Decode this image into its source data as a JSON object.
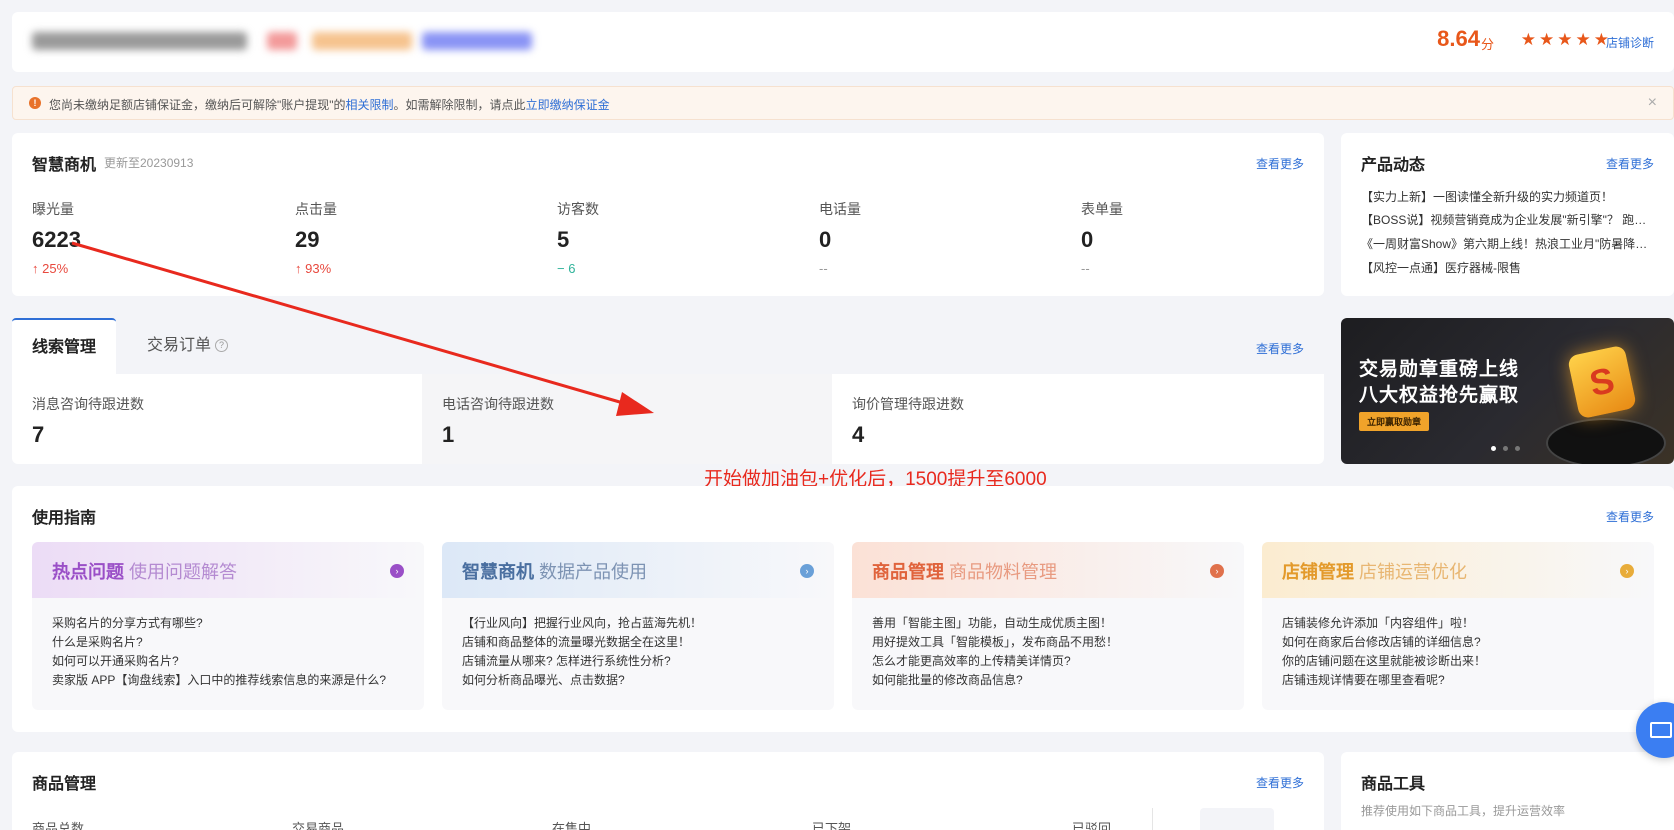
{
  "header": {
    "score": "8.64",
    "score_unit": "分",
    "stars": "★★★★★",
    "diagnosis_link": "店铺诊断"
  },
  "notice": {
    "text_a": "您尚未缴纳足额店铺保证金，缴纳后可解除\"账户提现\"的",
    "link_a": "相关限制",
    "text_b": "。如需解除限制，请点此",
    "link_b": "立即缴纳保证金",
    "close": "×"
  },
  "insights": {
    "title": "智慧商机",
    "update_note": "更新至20230913",
    "more": "查看更多",
    "metrics": [
      {
        "label": "曝光量",
        "value": "6223",
        "change": "25%",
        "trend": "↑"
      },
      {
        "label": "点击量",
        "value": "29",
        "change": "93%",
        "trend": "↑"
      },
      {
        "label": "访客数",
        "value": "5",
        "change": "6",
        "trend": "−"
      },
      {
        "label": "电话量",
        "value": "0",
        "change": "--",
        "trend": ""
      },
      {
        "label": "表单量",
        "value": "0",
        "change": "--",
        "trend": ""
      }
    ]
  },
  "news": {
    "title": "产品动态",
    "more": "查看更多",
    "items": [
      "【实力上新】一图读懂全新升级的实力频道页！",
      "【BOSS说】视频营销竟成为企业发展\"新引擎\"？ 跑…",
      "《一周财富Show》第六期上线！热浪工业月\"防暑降…",
      "【风控一点通】医疗器械-限售"
    ]
  },
  "leads": {
    "tab_active": "线索管理",
    "tab_other": "交易订单",
    "more": "查看更多",
    "boxes": [
      {
        "label": "消息咨询待跟进数",
        "value": "7"
      },
      {
        "label": "电话咨询待跟进数",
        "value": "1"
      },
      {
        "label": "询价管理待跟进数",
        "value": "4"
      }
    ]
  },
  "banner": {
    "line1": "交易勋章重磅上线",
    "line2": "八大权益抢先赢取",
    "button": "立即赢取勋章",
    "badge_letter": "S"
  },
  "annotation": "开始做加油包+优化后，1500提升至6000",
  "guide": {
    "title": "使用指南",
    "more": "查看更多",
    "cards": [
      {
        "bold": "热点问题",
        "rest": "使用问题解答",
        "color": "#9a4fc7",
        "questions": [
          "采购名片的分享方式有哪些?",
          "什么是采购名片?",
          "如何可以开通采购名片?",
          "卖家版 APP【询盘线索】入口中的推荐线索信息的来源是什么?"
        ]
      },
      {
        "bold": "智慧商机",
        "rest": "数据产品使用",
        "color": "#4a82c4",
        "questions": [
          "【行业风向】把握行业风向，抢占蓝海先机！",
          "店铺和商品整体的流量曝光数据全在这里！",
          "店铺流量从哪来? 怎样进行系统性分析?",
          "如何分析商品曝光、点击数据?"
        ]
      },
      {
        "bold": "商品管理",
        "rest": "商品物料管理",
        "color": "#e0633c",
        "questions": [
          "善用「智能主图」功能，自动生成优质主图！",
          "用好提效工具「智能模板」，发布商品不用愁！",
          "怎么才能更高效率的上传精美详情页?",
          "如何能批量的修改商品信息?"
        ]
      },
      {
        "bold": "店铺管理",
        "rest": "店铺运营优化",
        "color": "#e39a2b",
        "questions": [
          "店铺装修允许添加「内容组件」啦！",
          "如何在商家后台修改店铺的详细信息?",
          "你的店铺问题在这里就能被诊断出来！",
          "店铺违规详情要在哪里查看呢?"
        ]
      }
    ]
  },
  "goods": {
    "title": "商品管理",
    "more": "查看更多",
    "labels": [
      "商品总数",
      "交易商品",
      "在售中",
      "已下架",
      "已驳回"
    ]
  },
  "tools": {
    "title": "商品工具",
    "subtitle": "推荐使用如下商品工具，提升运营效率"
  }
}
